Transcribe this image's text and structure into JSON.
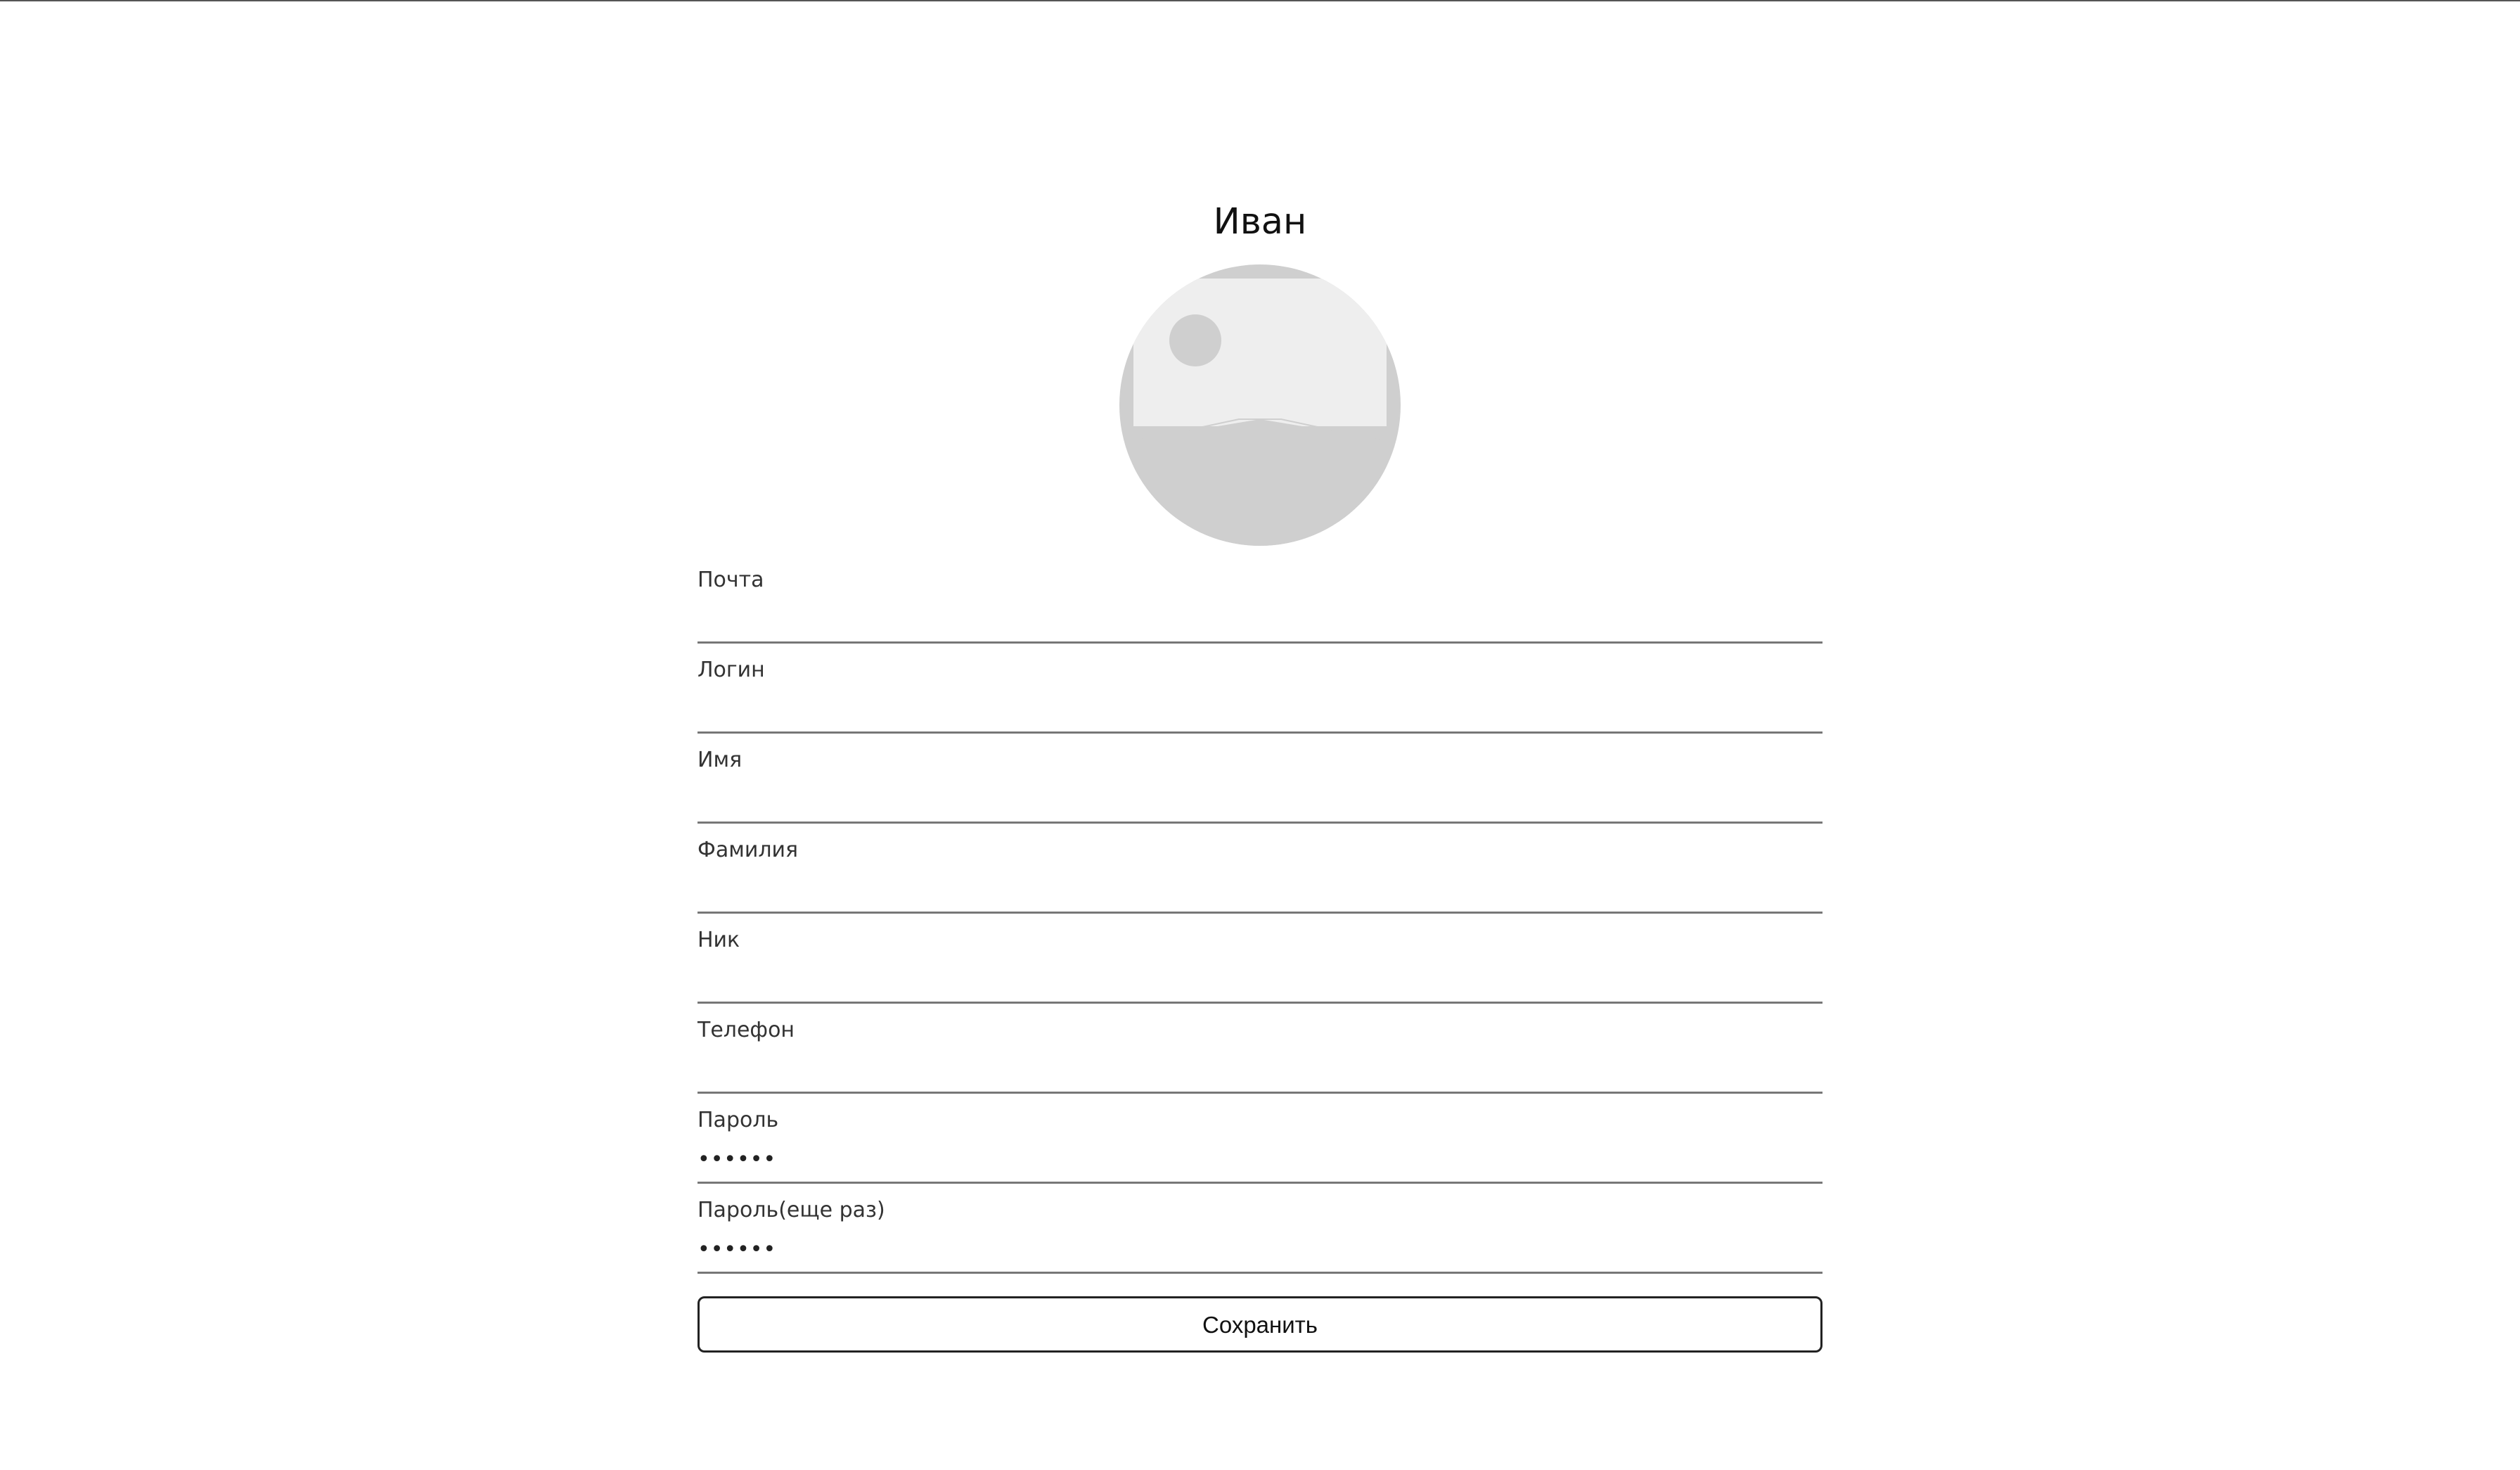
{
  "profile": {
    "name": "Иван",
    "avatar_icon": "image-placeholder-icon"
  },
  "form": {
    "fields": [
      {
        "label": "Почта",
        "value": "",
        "type": "email"
      },
      {
        "label": "Логин",
        "value": "",
        "type": "text"
      },
      {
        "label": "Имя",
        "value": "",
        "type": "text"
      },
      {
        "label": "Фамилия",
        "value": "",
        "type": "text"
      },
      {
        "label": "Ник",
        "value": "",
        "type": "text"
      },
      {
        "label": "Телефон",
        "value": "",
        "type": "tel"
      },
      {
        "label": "Пароль",
        "value": "••••••",
        "type": "password"
      },
      {
        "label": "Пароль(еще раз)",
        "value": "••••••",
        "type": "password"
      }
    ],
    "save_label": "Сохранить"
  },
  "colors": {
    "avatar_bg": "#cfcfcf",
    "avatar_frame": "#eeeeee",
    "border": "#777777",
    "text": "#333333"
  }
}
